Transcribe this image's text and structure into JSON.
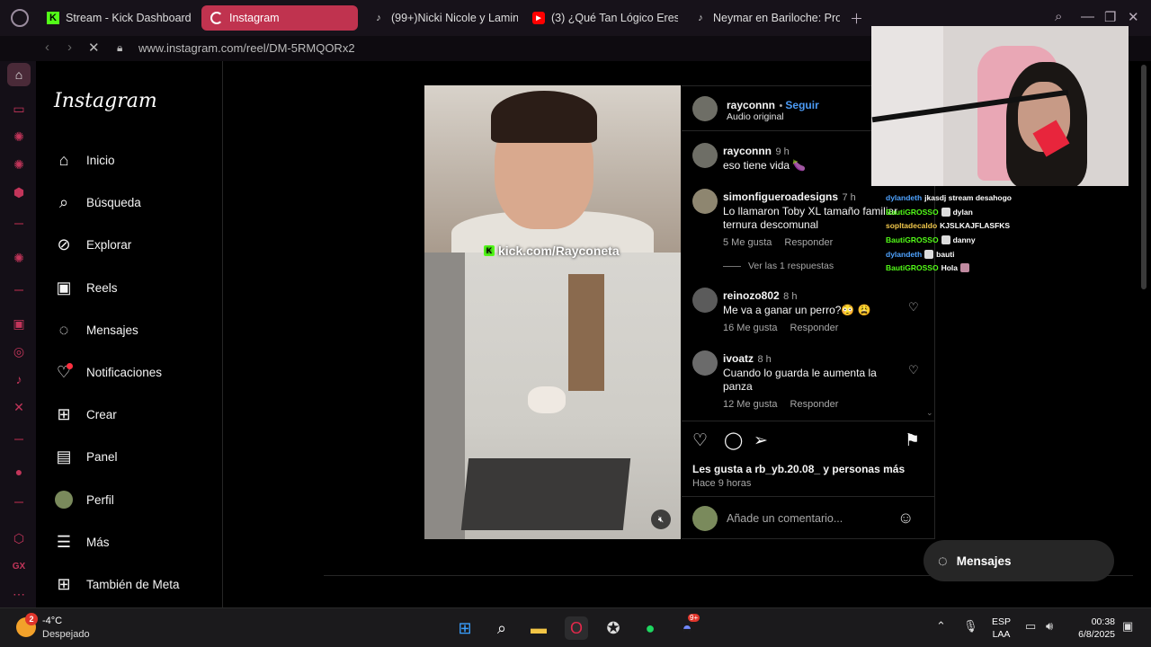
{
  "browser": {
    "tabs": [
      {
        "label": "Stream - Kick Dashboard",
        "icon": "kick-icon"
      },
      {
        "label": "Instagram",
        "icon": "loading-icon"
      },
      {
        "label": "(99+)Nicki Nicole y Lamin",
        "icon": "tiktok-icon"
      },
      {
        "label": "(3) ¿Qué Tan Lógico Eres",
        "icon": "youtube-icon"
      },
      {
        "label": "Neymar en Bariloche: Pro",
        "icon": "tiktok-icon"
      }
    ],
    "url": "www.instagram.com/reel/DM-5RMQORx2"
  },
  "instagram": {
    "logo": "Instagram",
    "nav": [
      {
        "label": "Inicio",
        "icon": "home-icon"
      },
      {
        "label": "Búsqueda",
        "icon": "search-icon"
      },
      {
        "label": "Explorar",
        "icon": "compass-icon"
      },
      {
        "label": "Reels",
        "icon": "reels-icon"
      },
      {
        "label": "Mensajes",
        "icon": "messenger-icon"
      },
      {
        "label": "Notificaciones",
        "icon": "heart-icon"
      },
      {
        "label": "Crear",
        "icon": "plus-square-icon"
      },
      {
        "label": "Panel",
        "icon": "chart-icon"
      },
      {
        "label": "Perfil",
        "icon": "avatar"
      },
      {
        "label": "Más",
        "icon": "menu-icon"
      },
      {
        "label": "También de Meta",
        "icon": "meta-apps-icon"
      }
    ]
  },
  "post": {
    "video_overlay": "kick.com/Rayconeta",
    "author": "rayconnn",
    "follow": "Seguir",
    "audio": "Audio original",
    "comments": [
      {
        "user": "rayconnn",
        "time": "9 h",
        "text": "eso tiene vida 🍆",
        "likes": "",
        "reply": ""
      },
      {
        "user": "simonfigueroadesigns",
        "time": "7 h",
        "text": "Lo llamaron Toby XL tamaño familiar ternura descomunal",
        "likes": "5 Me gusta",
        "reply": "Responder"
      },
      {
        "user": "reinozo802",
        "time": "8 h",
        "text": "Me va a ganar un perro?😳 😩",
        "likes": "16 Me gusta",
        "reply": "Responder"
      },
      {
        "user": "ivoatz",
        "time": "8 h",
        "text": "Cuando lo guarda le aumenta la panza",
        "likes": "12 Me gusta",
        "reply": "Responder"
      }
    ],
    "view_replies": "Ver las 1 respuestas",
    "likes_line": "Les gusta a rb_yb.20.08_ y personas más",
    "time_ago": "Hace 9 horas",
    "comment_placeholder": "Añade un comentario..."
  },
  "messages_pill": "Mensajes",
  "stream_chat": [
    {
      "user": "dylandeth",
      "msg": "jkasdj stream desahogo",
      "color": "#4fa3ff",
      "badge": false
    },
    {
      "user": "BautiGROSSO",
      "msg": "dylan",
      "color": "#53fc18",
      "badge": true
    },
    {
      "user": "sopltadecaldo",
      "msg": "KJSLKAJFLASFKS",
      "color": "#f2c84b",
      "badge": false
    },
    {
      "user": "BautiGROSSO",
      "msg": "danny",
      "color": "#53fc18",
      "badge": true
    },
    {
      "user": "dylandeth",
      "msg": "bauti",
      "color": "#4fa3ff",
      "badge": true
    },
    {
      "user": "BautiGROSSO",
      "msg": "Hola",
      "color": "#53fc18",
      "badge": true
    }
  ],
  "taskbar": {
    "weather_badge": "2",
    "weather_temp": "-4°C",
    "weather_desc": "Despejado",
    "spotify_like_badge": "",
    "discord_badge": "9+",
    "lang_1": "ESP",
    "lang_2": "LAA",
    "time": "00:38",
    "date": "6/8/2025"
  }
}
